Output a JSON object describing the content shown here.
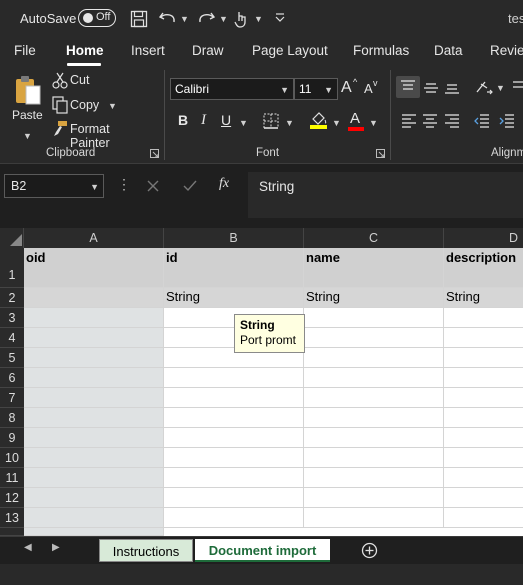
{
  "titlebar": {
    "autosave_label": "AutoSave",
    "autosave_state": "Off",
    "title_fragment": "tes"
  },
  "menu_tabs": [
    "File",
    "Home",
    "Insert",
    "Draw",
    "Page Layout",
    "Formulas",
    "Data",
    "Review"
  ],
  "ribbon": {
    "clipboard": {
      "paste_label": "Paste",
      "cut_label": "Cut",
      "copy_label": "Copy",
      "format_painter_label": "Format Painter",
      "group_label": "Clipboard"
    },
    "font": {
      "font_name": "Calibri",
      "font_size": "11",
      "bold": "B",
      "italic": "I",
      "underline": "U",
      "grow": "A",
      "shrink": "A",
      "font_color_letter": "A",
      "group_label": "Font",
      "highlight_color": "#ffff00",
      "font_color": "#ff0000"
    },
    "alignment": {
      "group_label": "Alignm"
    }
  },
  "formula_bar": {
    "name_box": "B2",
    "fx_label": "fx",
    "content": "String"
  },
  "sheet": {
    "columns": [
      "A",
      "B",
      "C",
      "D"
    ],
    "row_numbers": [
      "1",
      "2",
      "3",
      "4",
      "5",
      "6",
      "7",
      "8",
      "9",
      "10",
      "11",
      "12",
      "13"
    ],
    "header_row": [
      "oid",
      "id",
      "name",
      "description"
    ],
    "type_row": [
      "",
      "String",
      "String",
      "String"
    ]
  },
  "tooltip": {
    "title": "String",
    "body": "Port promt"
  },
  "sheet_tabs": {
    "tab1": "Instructions",
    "tab2": "Document import"
  }
}
